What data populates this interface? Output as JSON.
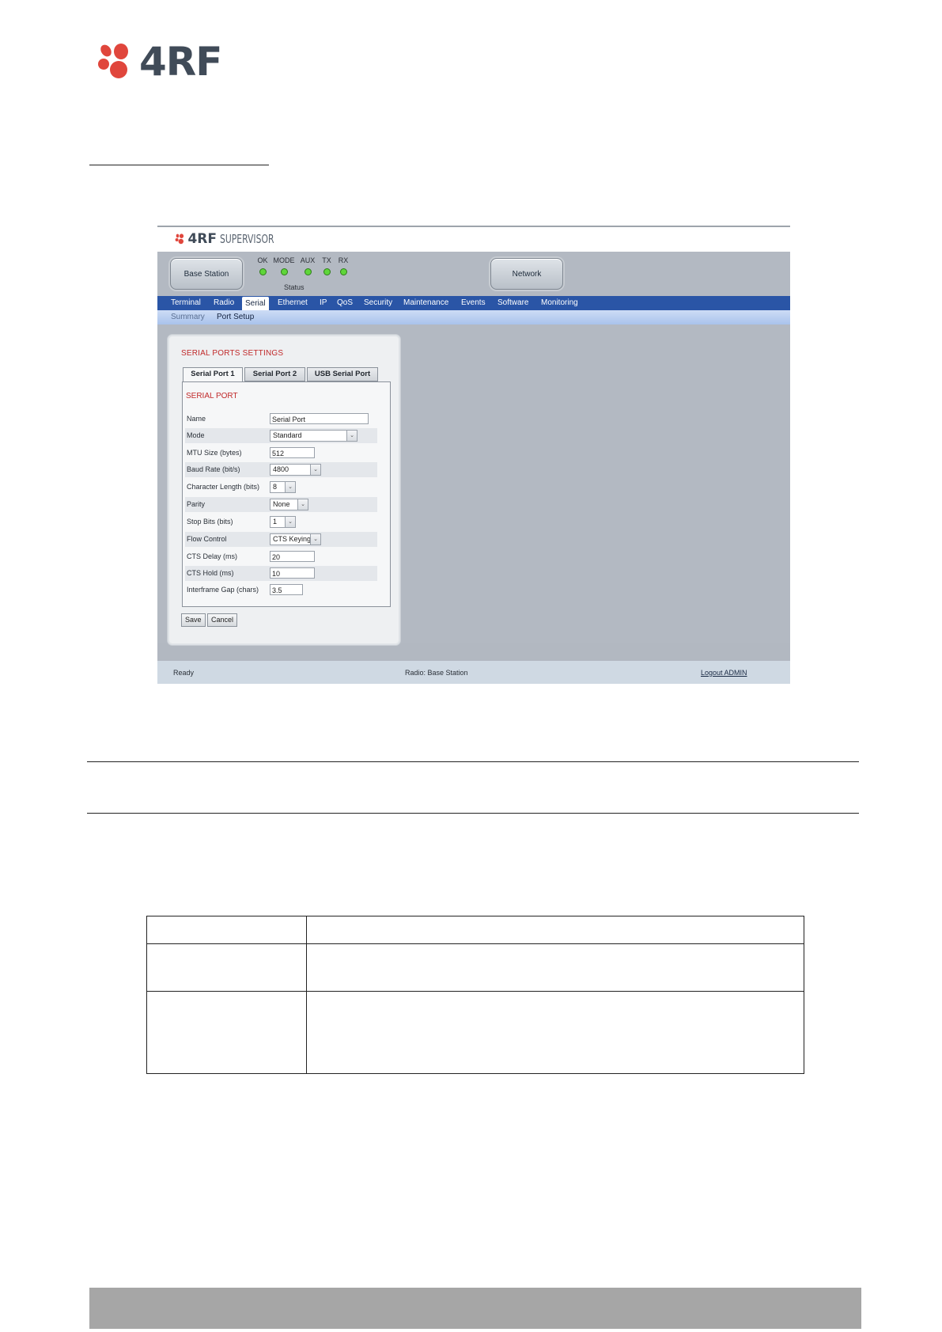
{
  "brand": {
    "logo_text": "4RF",
    "logo_color": "#404b58",
    "accent_color": "#e0463c"
  },
  "supervisor": {
    "logo_brand": "4RF",
    "logo_product": "SUPERVISOR",
    "base_station_label": "Base Station",
    "network_label": "Network",
    "leds": [
      {
        "label": "OK"
      },
      {
        "label": "MODE"
      },
      {
        "label": "AUX"
      },
      {
        "label": "TX"
      },
      {
        "label": "RX"
      }
    ],
    "status_caption": "Status",
    "nav": [
      "Terminal",
      "Radio",
      "Serial",
      "Ethernet",
      "IP",
      "QoS",
      "Security",
      "Maintenance",
      "Events",
      "Software",
      "Monitoring"
    ],
    "active_nav": "Serial",
    "subnav": [
      "Summary",
      "Port Setup"
    ],
    "active_subnav": "Port Setup",
    "panel_title": "SERIAL PORTS SETTINGS",
    "tabs": [
      "Serial Port 1",
      "Serial Port 2",
      "USB Serial Port"
    ],
    "active_tab": "Serial Port 1",
    "section_title": "SERIAL PORT",
    "fields": [
      {
        "label": "Name",
        "value": "Serial Port",
        "control": "text"
      },
      {
        "label": "Mode",
        "value": "Standard",
        "control": "select"
      },
      {
        "label": "MTU Size (bytes)",
        "value": "512",
        "control": "text"
      },
      {
        "label": "Baud Rate (bit/s)",
        "value": "4800",
        "control": "select"
      },
      {
        "label": "Character Length (bits)",
        "value": "8",
        "control": "select"
      },
      {
        "label": "Parity",
        "value": "None",
        "control": "select"
      },
      {
        "label": "Stop Bits (bits)",
        "value": "1",
        "control": "select"
      },
      {
        "label": "Flow Control",
        "value": "CTS Keying",
        "control": "select"
      },
      {
        "label": "CTS Delay (ms)",
        "value": "20",
        "control": "text"
      },
      {
        "label": "CTS Hold (ms)",
        "value": "10",
        "control": "text"
      },
      {
        "label": "Interframe Gap (chars)",
        "value": "3.5",
        "control": "text"
      }
    ],
    "save_label": "Save",
    "cancel_label": "Cancel",
    "status_left": "Ready",
    "status_center": "Radio: Base Station",
    "logout_label": "Logout ADMIN",
    "colors": {
      "nav_bar": "#2a55a6",
      "section_title": "#c0292a",
      "led_on": "#5fd63a"
    }
  }
}
